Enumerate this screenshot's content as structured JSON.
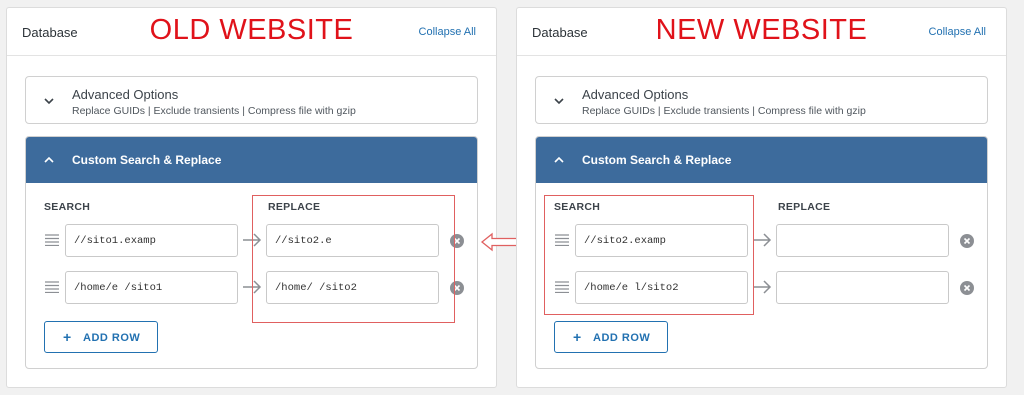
{
  "left": {
    "section": "Database",
    "title": "OLD WEBSITE",
    "collapse_all": "Collapse All",
    "advanced": {
      "title": "Advanced Options",
      "subtitle": "Replace GUIDs | Exclude transients | Compress file with gzip"
    },
    "custom": {
      "title": "Custom Search & Replace",
      "search_label": "SEARCH",
      "replace_label": "REPLACE",
      "rows": [
        {
          "search": "//sito1.examp",
          "replace": "//sito2.e"
        },
        {
          "search": "/home/e      /sito1",
          "replace": "/home/        /sito2"
        }
      ],
      "add_row": "ADD ROW"
    }
  },
  "right": {
    "section": "Database",
    "title": "NEW WEBSITE",
    "collapse_all": "Collapse All",
    "advanced": {
      "title": "Advanced Options",
      "subtitle": "Replace GUIDs | Exclude transients | Compress file with gzip"
    },
    "custom": {
      "title": "Custom Search & Replace",
      "search_label": "SEARCH",
      "replace_label": "REPLACE",
      "rows": [
        {
          "search": "//sito2.examp",
          "replace": ""
        },
        {
          "search": "/home/e      l/sito2",
          "replace": ""
        }
      ],
      "add_row": "ADD ROW"
    }
  },
  "colors": {
    "accent": "#2271b1",
    "header_blue": "#3d6b9c",
    "highlight_red": "#e06060",
    "title_red": "#e0121a"
  }
}
